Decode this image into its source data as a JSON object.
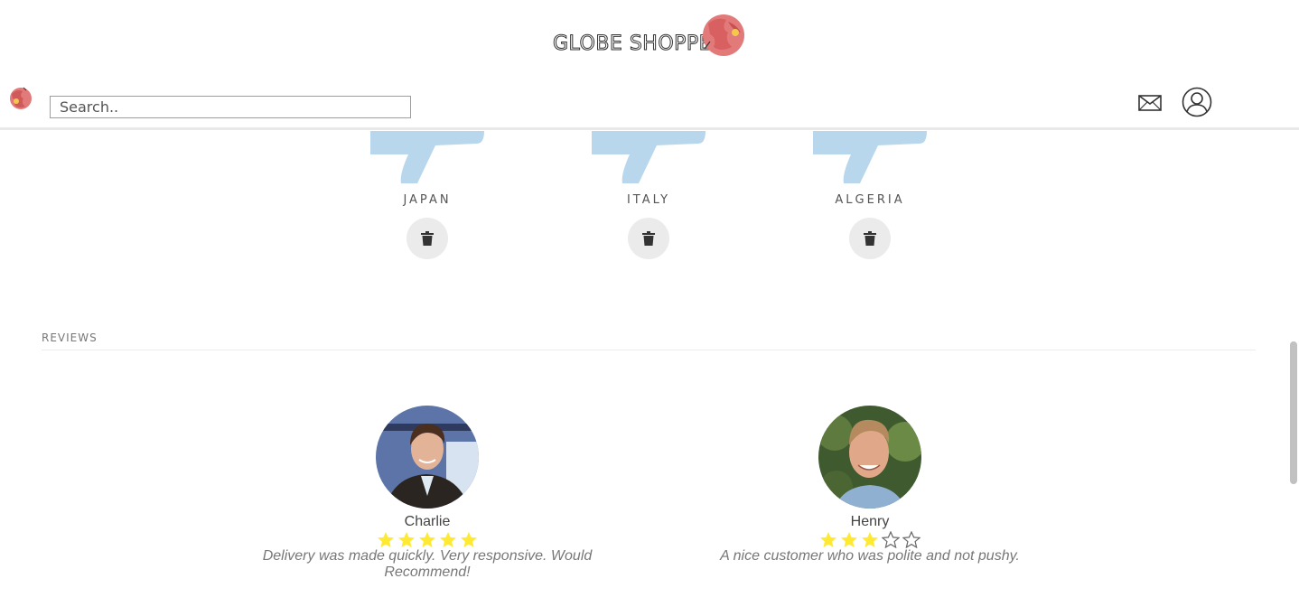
{
  "brand": {
    "name": "GLOBE SHOPPERS"
  },
  "navbar": {
    "search_placeholder": "Search..",
    "icons": [
      "globe-logo-icon",
      "mail-icon",
      "user-account-icon"
    ]
  },
  "countries": [
    {
      "name": "JAPAN"
    },
    {
      "name": "ITALY"
    },
    {
      "name": "ALGERIA"
    }
  ],
  "reviews": {
    "heading": "REVIEWS",
    "items": [
      {
        "name": "Charlie",
        "rating": 5,
        "max_rating": 5,
        "text": "Delivery was made quickly. Very responsive. Would Recommend!"
      },
      {
        "name": "Henry",
        "rating": 3,
        "max_rating": 5,
        "text": "A nice customer who was polite and not pushy."
      }
    ]
  },
  "colors": {
    "star_filled": "#ffe933",
    "flag_blue": "#b9d7ec",
    "globe_red": "#e07070",
    "delete_bg": "#ebebeb"
  }
}
